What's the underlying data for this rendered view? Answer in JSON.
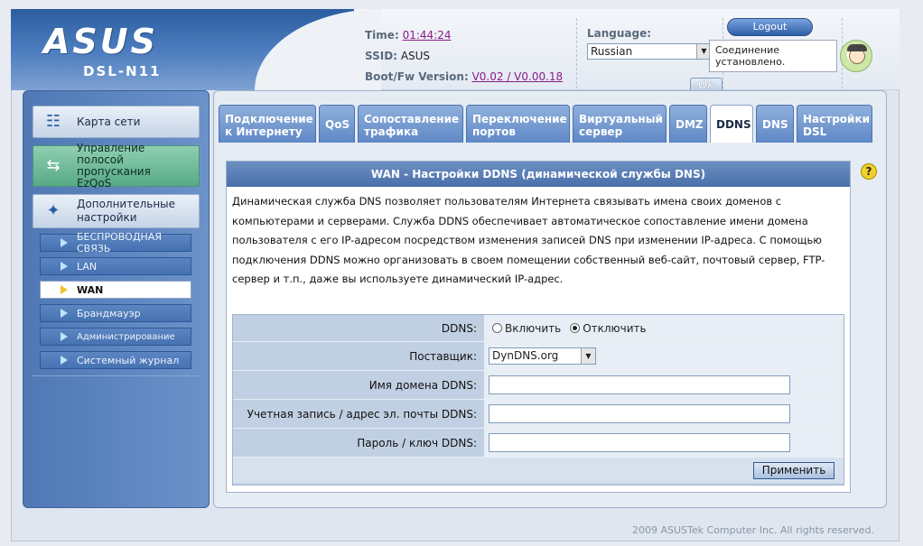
{
  "header": {
    "brand": "ASUS",
    "model": "DSL-N11",
    "time_label": "Time:",
    "time_value": "01:44:24",
    "ssid_label": "SSID:",
    "ssid_value": "ASUS",
    "fw_label": "Boot/Fw Version:",
    "fw_value": "V0.02 / V0.00.18",
    "language_label": "Language:",
    "language_value": "Russian",
    "ok_label": "Ok",
    "logout_label": "Logout",
    "status_text": "Соединение установлено."
  },
  "sidebar": {
    "main": [
      {
        "label": "Карта сети"
      },
      {
        "label": "Управление полосой пропускания EzQoS"
      },
      {
        "label": "Дополнительные настройки"
      }
    ],
    "sub": [
      {
        "label": "БЕСПРОВОДНАЯ СВЯЗЬ"
      },
      {
        "label": "LAN"
      },
      {
        "label": "WAN"
      },
      {
        "label": "Брандмауэр"
      },
      {
        "label": "Администрирование"
      },
      {
        "label": "Системный журнал"
      }
    ]
  },
  "tabs": [
    {
      "label": "Подключение к Интернету"
    },
    {
      "label": "QoS"
    },
    {
      "label": "Сопоставление трафика"
    },
    {
      "label": "Переключение портов"
    },
    {
      "label": "Виртуальный сервер"
    },
    {
      "label": "DMZ"
    },
    {
      "label": "DDNS"
    },
    {
      "label": "DNS"
    },
    {
      "label": "Настройки DSL"
    }
  ],
  "content": {
    "title": "WAN - Настройки DDNS (динамической службы DNS)",
    "description": "Динамическая служба DNS позволяет пользователям Интернета связывать имена своих доменов с компьютерами и серверами. Служба DDNS обеспечивает автоматическое сопоставление имени домена пользователя с его IP-адресом посредством изменения записей DNS при изменении IP-адреса. С помощью подключения DDNS можно организовать в своем помещении собственный веб-сайт, почтовый сервер, FTP-сервер и т.п., даже вы используете динамический IP-адрес."
  },
  "form": {
    "ddns_label": "DDNS:",
    "enable_label": "Включить",
    "disable_label": "Отключить",
    "selected": "disable",
    "provider_label": "Поставщик:",
    "provider_value": "DynDNS.org",
    "domain_label": "Имя домена DDNS:",
    "domain_value": "",
    "account_label": "Учетная запись / адрес эл. почты DDNS:",
    "account_value": "",
    "password_label": "Пароль / ключ DDNS:",
    "password_value": "",
    "apply_label": "Применить"
  },
  "footer": {
    "copyright": "2009 ASUSTek Computer Inc. All rights reserved."
  }
}
